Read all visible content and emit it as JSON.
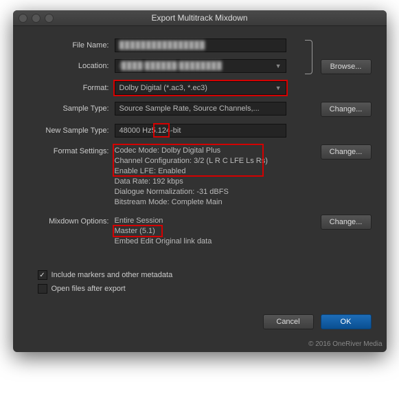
{
  "title": "Export Multitrack Mixdown",
  "labels": {
    "fileName": "File Name:",
    "location": "Location:",
    "format": "Format:",
    "sampleType": "Sample Type:",
    "newSampleType": "New Sample Type:",
    "formatSettings": "Format Settings:",
    "mixdownOptions": "Mixdown Options:"
  },
  "values": {
    "fileName": "████████████████",
    "location": "/████/██████/████████",
    "format": "Dolby Digital (*.ac3, *.ec3)",
    "sampleType": "Source Sample Rate, Source Channels,...",
    "newSampleType_pre": "48000 Hz ",
    "newSampleType_hl": "5.1",
    "newSampleType_post": " 24-bit"
  },
  "formatSettings": {
    "l1": "Codec Mode: Dolby Digital Plus",
    "l2": "Channel Configuration: 3/2 (L R C LFE Ls Rs)",
    "l3": "Enable LFE: Enabled",
    "l4": "Data Rate: 192 kbps",
    "l5": "Dialogue Normalization: -31 dBFS",
    "l6": "Bitstream Mode: Complete Main"
  },
  "mixdown": {
    "l1": "Entire Session",
    "l2": "Master (5.1)",
    "l3": "Embed Edit Original link data"
  },
  "checks": {
    "includeMarkers": "Include markers and other metadata",
    "openAfter": "Open files after export"
  },
  "buttons": {
    "browse": "Browse...",
    "change": "Change...",
    "cancel": "Cancel",
    "ok": "OK"
  },
  "copyright": "© 2016 OneRiver Media"
}
